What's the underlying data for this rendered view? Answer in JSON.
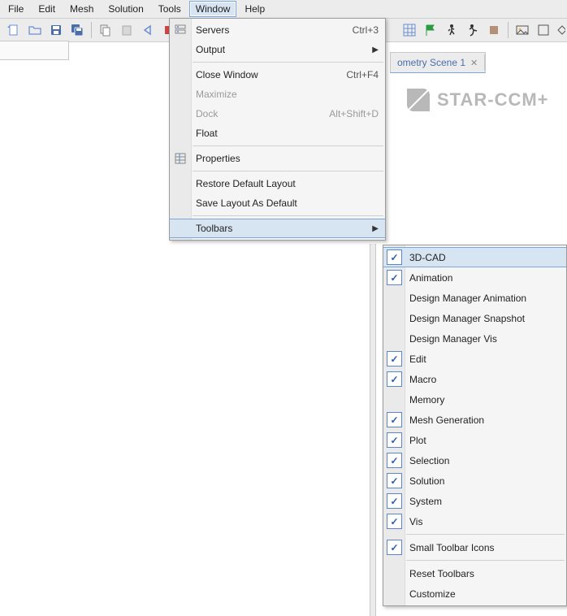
{
  "menubar": [
    {
      "label": "File",
      "active": false
    },
    {
      "label": "Edit",
      "active": false
    },
    {
      "label": "Mesh",
      "active": false
    },
    {
      "label": "Solution",
      "active": false
    },
    {
      "label": "Tools",
      "active": false
    },
    {
      "label": "Window",
      "active": true
    },
    {
      "label": "Help",
      "active": false
    }
  ],
  "scene_tab": {
    "label": "ometry Scene 1"
  },
  "logo_text": "STAR-CCM+",
  "window_menu": {
    "items": [
      {
        "type": "item",
        "label": "Servers",
        "shortcut": "Ctrl+3",
        "icon": "servers-icon"
      },
      {
        "type": "item",
        "label": "Output",
        "submenu": true
      },
      {
        "type": "sep"
      },
      {
        "type": "item",
        "label": "Close Window",
        "shortcut": "Ctrl+F4"
      },
      {
        "type": "item",
        "label": "Maximize",
        "disabled": true
      },
      {
        "type": "item",
        "label": "Dock",
        "shortcut": "Alt+Shift+D",
        "disabled": true
      },
      {
        "type": "item",
        "label": "Float"
      },
      {
        "type": "sep"
      },
      {
        "type": "item",
        "label": "Properties",
        "icon": "properties-icon"
      },
      {
        "type": "sep"
      },
      {
        "type": "item",
        "label": "Restore Default Layout"
      },
      {
        "type": "item",
        "label": "Save Layout As Default"
      },
      {
        "type": "sep"
      },
      {
        "type": "item",
        "label": "Toolbars",
        "submenu": true,
        "highlight": true
      }
    ]
  },
  "toolbars_submenu": {
    "items": [
      {
        "type": "check",
        "label": "3D-CAD",
        "checked": true,
        "highlight": true
      },
      {
        "type": "check",
        "label": "Animation",
        "checked": true
      },
      {
        "type": "check",
        "label": "Design Manager Animation",
        "checked": false
      },
      {
        "type": "check",
        "label": "Design Manager Snapshot",
        "checked": false
      },
      {
        "type": "check",
        "label": "Design Manager Vis",
        "checked": false
      },
      {
        "type": "check",
        "label": "Edit",
        "checked": true
      },
      {
        "type": "check",
        "label": "Macro",
        "checked": true
      },
      {
        "type": "check",
        "label": "Memory",
        "checked": false
      },
      {
        "type": "check",
        "label": "Mesh Generation",
        "checked": true
      },
      {
        "type": "check",
        "label": "Plot",
        "checked": true
      },
      {
        "type": "check",
        "label": "Selection",
        "checked": true
      },
      {
        "type": "check",
        "label": "Solution",
        "checked": true
      },
      {
        "type": "check",
        "label": "System",
        "checked": true
      },
      {
        "type": "check",
        "label": "Vis",
        "checked": true
      },
      {
        "type": "sep"
      },
      {
        "type": "check",
        "label": "Small Toolbar Icons",
        "checked": true
      },
      {
        "type": "sep"
      },
      {
        "type": "item",
        "label": "Reset Toolbars"
      },
      {
        "type": "item",
        "label": "Customize"
      }
    ]
  }
}
